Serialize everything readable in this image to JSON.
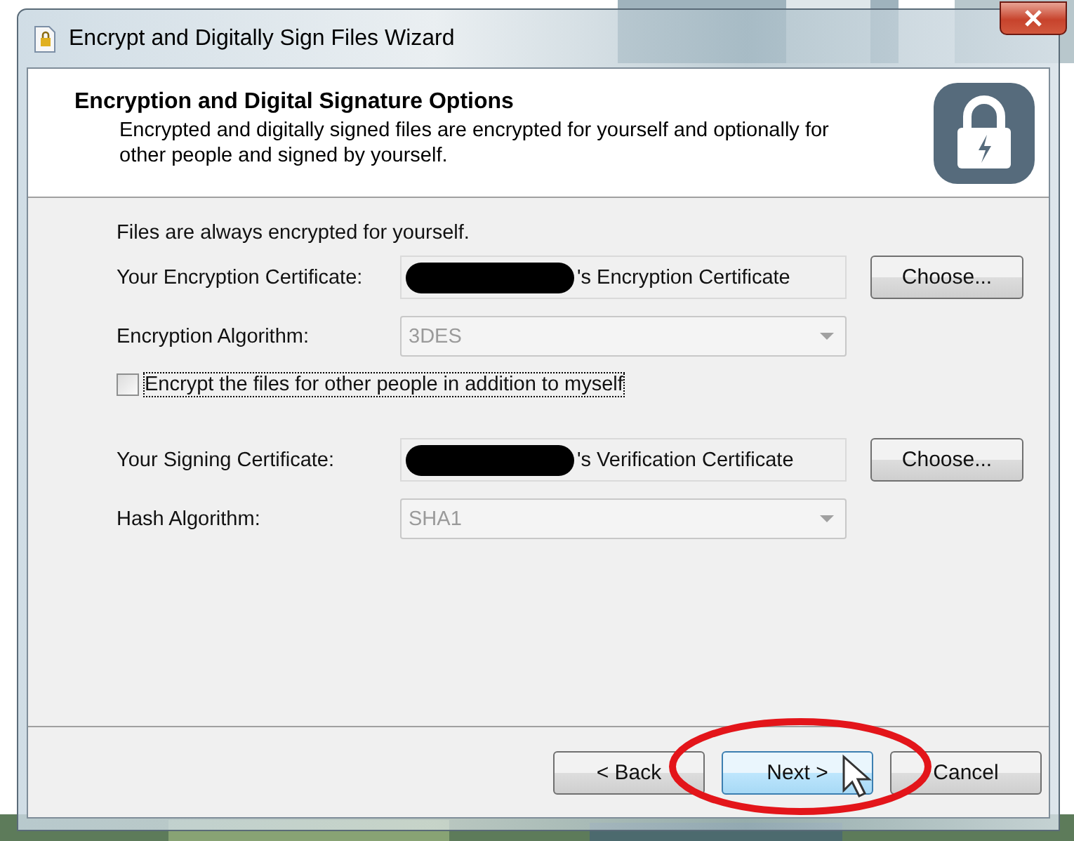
{
  "window": {
    "title": "Encrypt and Digitally Sign Files Wizard"
  },
  "header": {
    "title": "Encryption and Digital Signature Options",
    "description": "Encrypted and digitally signed files are encrypted for yourself and optionally for other people and signed by yourself."
  },
  "intro": "Files are always encrypted for yourself.",
  "rows": [
    {
      "kind": "certificate",
      "label": "Your Encryption Certificate:",
      "value": "'s Encryption Certificate",
      "redacted": true,
      "button": "Choose..."
    },
    {
      "kind": "dropdown",
      "label": "Encryption Algorithm:",
      "value": "3DES",
      "disabled": true
    },
    {
      "kind": "checkbox",
      "label": "Encrypt the files for other people in addition to myself",
      "checked": false,
      "focused": true
    },
    {
      "kind": "certificate",
      "label": "Your Signing Certificate:",
      "value": "'s Verification Certificate",
      "redacted": true,
      "button": "Choose..."
    },
    {
      "kind": "dropdown",
      "label": "Hash Algorithm:",
      "value": "SHA1",
      "disabled": true
    }
  ],
  "buttons": [
    {
      "label": "< Back",
      "highlighted": false
    },
    {
      "label": "Next >",
      "highlighted": true
    },
    {
      "label": "Cancel",
      "highlighted": false
    }
  ],
  "annotation": {
    "kind": "ellipse"
  }
}
